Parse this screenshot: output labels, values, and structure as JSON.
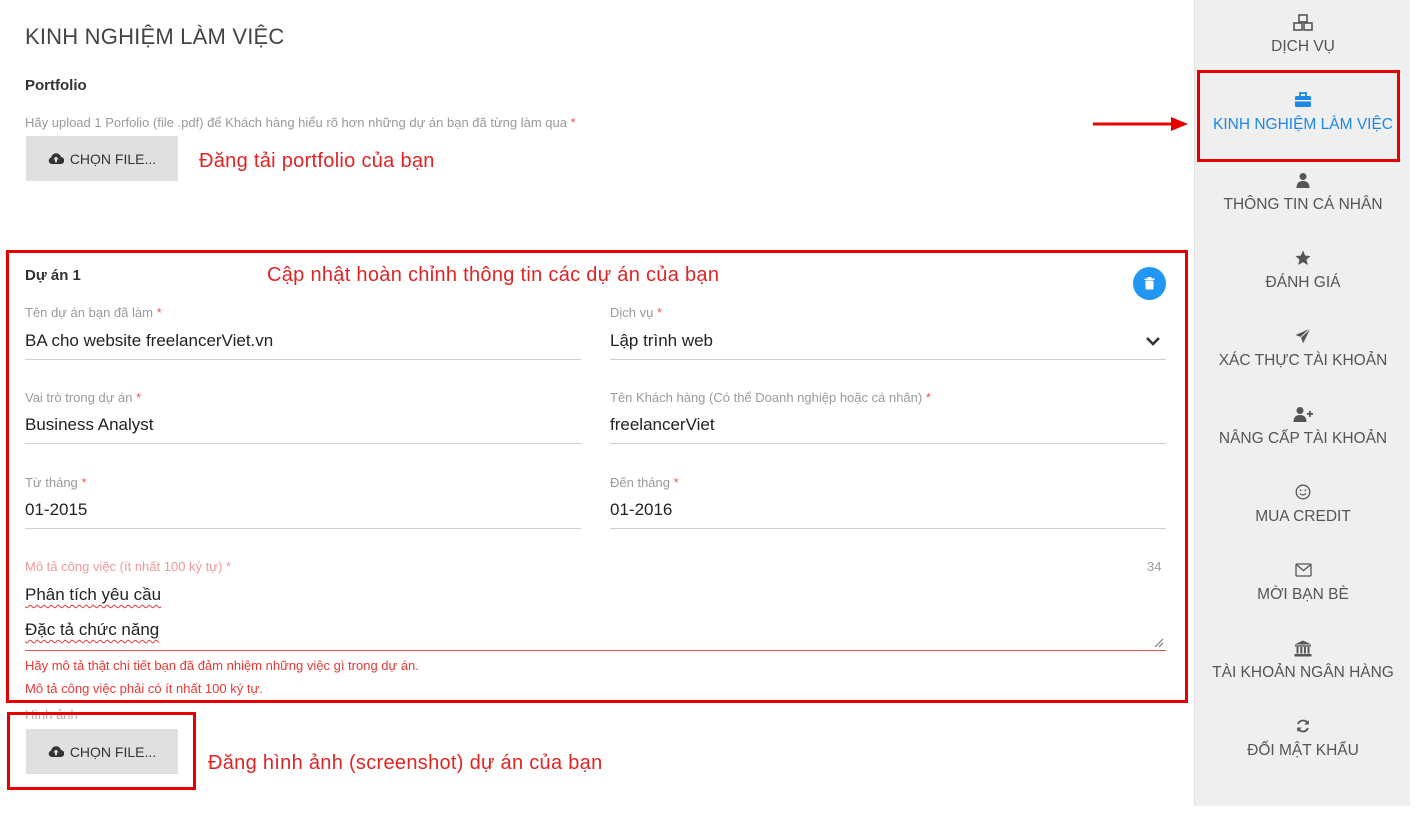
{
  "main": {
    "title": "KINH NGHIỆM LÀM VIỆC",
    "portfolio": {
      "label": "Portfolio",
      "hint": "Hãy upload 1 Porfolio (file .pdf) để Khách hàng hiểu rõ hơn những dự án bạn đã từng làm qua",
      "required_mark": "*",
      "button_label": "CHỌN FILE..."
    },
    "project": {
      "title": "Dự án 1",
      "fields": {
        "project_name": {
          "label": "Tên dự án bạn đã làm",
          "value": "BA cho website freelancerViet.vn"
        },
        "service": {
          "label": "Dịch vụ",
          "value": "Lập trình web"
        },
        "role": {
          "label": "Vai trò trong dự án",
          "value": "Business Analyst"
        },
        "client": {
          "label": "Tên Khách hàng (Có thể Doanh nghiệp hoặc cá nhân)",
          "value": "freelancerViet"
        },
        "from_month": {
          "label": "Từ tháng",
          "value": "01-2015"
        },
        "to_month": {
          "label": "Đến tháng",
          "value": "01-2016"
        }
      },
      "description": {
        "label": "Mô tả công việc (ít nhất 100 ký tự)",
        "counter": "34",
        "lines": [
          "Phân tích yêu cầu",
          "Đặc tả chức năng"
        ],
        "errors": [
          "Hãy mô tả thật chi tiết bạn đã đảm nhiệm những việc gì trong dự án.",
          "Mô tả công việc phải có ít nhất 100 ký tự."
        ]
      },
      "images": {
        "label": "Hình ảnh",
        "button_label": "CHỌN FILE..."
      }
    }
  },
  "annotations": {
    "portfolio": "Đăng tải portfolio của bạn",
    "project": "Cập nhật hoàn chỉnh thông tin các dự án của bạn",
    "images": "Đăng hình ảnh (screenshot) dự án của bạn"
  },
  "sidebar": {
    "items": [
      {
        "label": "DỊCH VỤ",
        "icon": "cubes-icon"
      },
      {
        "label": "KINH NGHIỆM LÀM VIỆC",
        "icon": "briefcase-icon",
        "active": true
      },
      {
        "label": "THÔNG TIN CÁ NHÂN",
        "icon": "user-icon"
      },
      {
        "label": "ĐÁNH GIÁ",
        "icon": "star-icon"
      },
      {
        "label": "XÁC THỰC TÀI KHOẢN",
        "icon": "paper-plane-icon"
      },
      {
        "label": "NÂNG CẤP TÀI KHOẢN",
        "icon": "user-plus-icon"
      },
      {
        "label": "MUA CREDIT",
        "icon": "smile-icon"
      },
      {
        "label": "MỜI BẠN BÈ",
        "icon": "envelope-icon"
      },
      {
        "label": "TÀI KHOẢN NGÂN HÀNG",
        "icon": "bank-icon"
      },
      {
        "label": "ĐỔI MẬT KHẨU",
        "icon": "refresh-icon"
      }
    ]
  },
  "colors": {
    "accent": "#1e88e5",
    "annotation_red": "#e60000",
    "error_red": "#e53935",
    "delete_button": "#2196f3"
  }
}
